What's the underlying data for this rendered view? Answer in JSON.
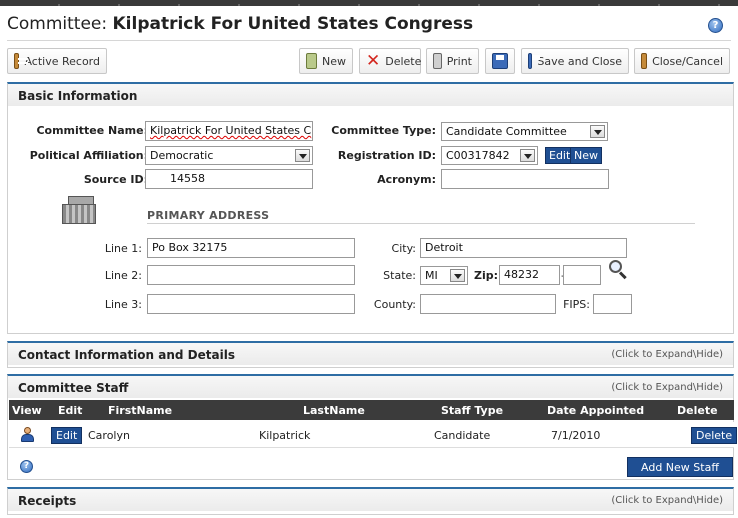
{
  "header": {
    "title_prefix": "Committee:",
    "title_name": "Kilpatrick For United States Congress",
    "help_icon": "?"
  },
  "toolbar": {
    "active_record": "Active Record",
    "new": "New",
    "delete": "Delete",
    "print": "Print",
    "save_and_close": "Save and Close",
    "close_cancel": "Close/Cancel"
  },
  "basic": {
    "heading": "Basic Information",
    "committee_name_label": "Committee Name:",
    "committee_name_value": "Kilpatrick For United States C",
    "committee_type_label": "Committee Type:",
    "committee_type_value": "Candidate Committee",
    "political_affiliation_label": "Political Affiliation:",
    "political_affiliation_value": "Democratic",
    "registration_id_label": "Registration ID:",
    "registration_id_value": "C00317842",
    "edit_label": "Edit",
    "new_label": "New",
    "source_id_label": "Source ID:",
    "source_id_value": "14558",
    "acronym_label": "Acronym:",
    "acronym_value": ""
  },
  "address": {
    "heading": "PRIMARY ADDRESS",
    "line1_label": "Line 1:",
    "line1_value": "Po Box 32175",
    "line2_label": "Line 2:",
    "line2_value": "",
    "line3_label": "Line 3:",
    "line3_value": "",
    "city_label": "City:",
    "city_value": "Detroit",
    "state_label": "State:",
    "state_value": "MI",
    "zip_label": "Zip:",
    "zip_value": "48232",
    "zip_sep": "-",
    "zip_ext_value": "",
    "county_label": "County:",
    "county_value": "",
    "fips_label": "FIPS:",
    "fips_value": ""
  },
  "contact": {
    "heading": "Contact Information and Details",
    "expand": "(Click to Expand\\Hide)"
  },
  "staff": {
    "heading": "Committee Staff",
    "expand": "(Click to Expand\\Hide)",
    "columns": [
      "View",
      "Edit",
      "FirstName",
      "LastName",
      "Staff Type",
      "Date Appointed",
      "Delete"
    ],
    "rows": [
      {
        "edit": "Edit",
        "first": "Carolyn",
        "last": "Kilpatrick",
        "type": "Candidate",
        "date": "7/1/2010",
        "delete": "Delete"
      }
    ],
    "help": "?",
    "add_button": "Add New Staff"
  },
  "receipts": {
    "heading": "Receipts",
    "expand": "(Click to Expand\\Hide)"
  }
}
